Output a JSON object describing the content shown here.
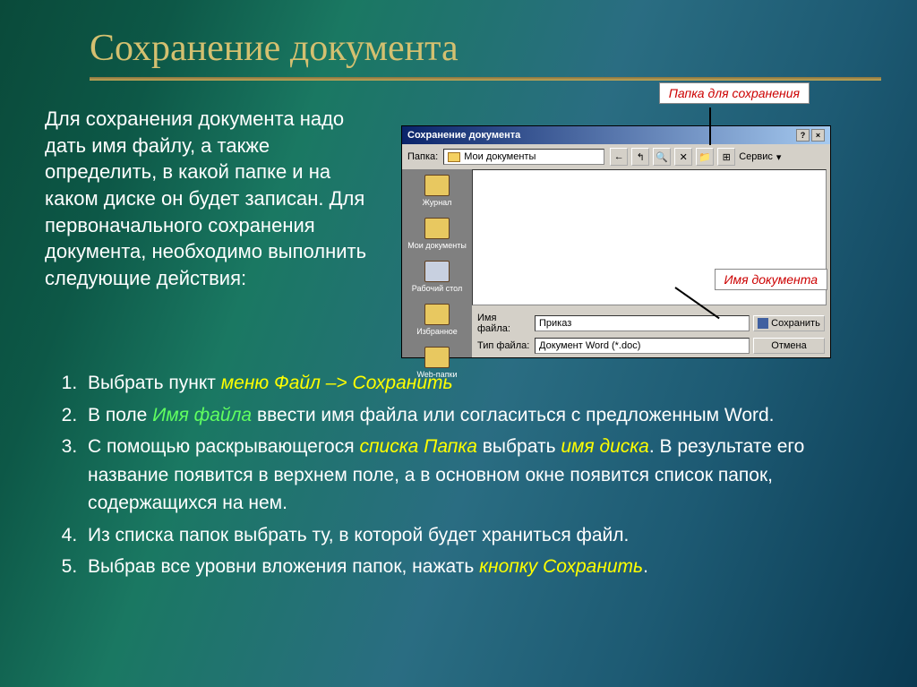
{
  "slide": {
    "title": "Сохранение документа",
    "intro": "Для сохранения документа надо дать имя файлу, а также определить, в какой папке и на каком диске он будет записан. Для первоначального сохранения документа, необходимо выполнить следующие действия:"
  },
  "callouts": {
    "folder": "Папка для сохранения",
    "filename": "Имя документа"
  },
  "dialog": {
    "title": "Сохранение документа",
    "folder_label": "Папка:",
    "folder_value": "Мои документы",
    "service_label": "Сервис",
    "sidebar": [
      "Журнал",
      "Мои документы",
      "Рабочий стол",
      "Избранное",
      "Web-папки"
    ],
    "filename_label": "Имя файла:",
    "filename_value": "Приказ",
    "filetype_label": "Тип файла:",
    "filetype_value": "Документ Word (*.doc)",
    "save_btn": "Сохранить",
    "cancel_btn": "Отмена"
  },
  "steps": {
    "s1_a": "Выбрать пункт ",
    "s1_b": "меню Файл –> Сохранить",
    "s2_a": "В поле ",
    "s2_b": "Имя файла",
    "s2_c": " ввести имя файла или согласиться с предложенным Word.",
    "s3_a": "С помощью раскрывающегося ",
    "s3_b": "списка Папка",
    "s3_c": " выбрать ",
    "s3_d": "имя диска",
    "s3_e": ". В результате его название появится в верхнем поле, а в основном окне появится список папок, содержащихся на нем.",
    "s4": "Из списка папок выбрать ту, в которой будет храниться файл.",
    "s5_a": "Выбрав все уровни вложения папок, нажать ",
    "s5_b": "кнопку Сохранить",
    "s5_c": "."
  }
}
